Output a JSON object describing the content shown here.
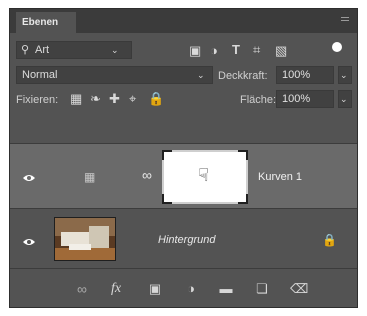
{
  "panel": {
    "tab_label": "Ebenen"
  },
  "filter": {
    "kind_label": "Art",
    "icons": [
      "image-filter-icon",
      "adjustment-filter-icon",
      "type-filter-icon",
      "shape-filter-icon",
      "smart-object-filter-icon",
      "filter-toggle-icon"
    ]
  },
  "blend": {
    "mode": "Normal",
    "opacity_label": "Deckkraft:",
    "opacity_value": "100%"
  },
  "lock": {
    "label": "Fixieren:",
    "fill_label": "Fläche:",
    "fill_value": "100%"
  },
  "layers": [
    {
      "name": "Kurven 1",
      "visible": true,
      "selected": true,
      "type": "adjustment"
    },
    {
      "name": "Hintergrund",
      "visible": true,
      "selected": false,
      "type": "image"
    }
  ],
  "colors": {
    "panel_bg": "#535353",
    "selected_row": "#6a6a6a",
    "tab_bar": "#3b3b3b"
  }
}
